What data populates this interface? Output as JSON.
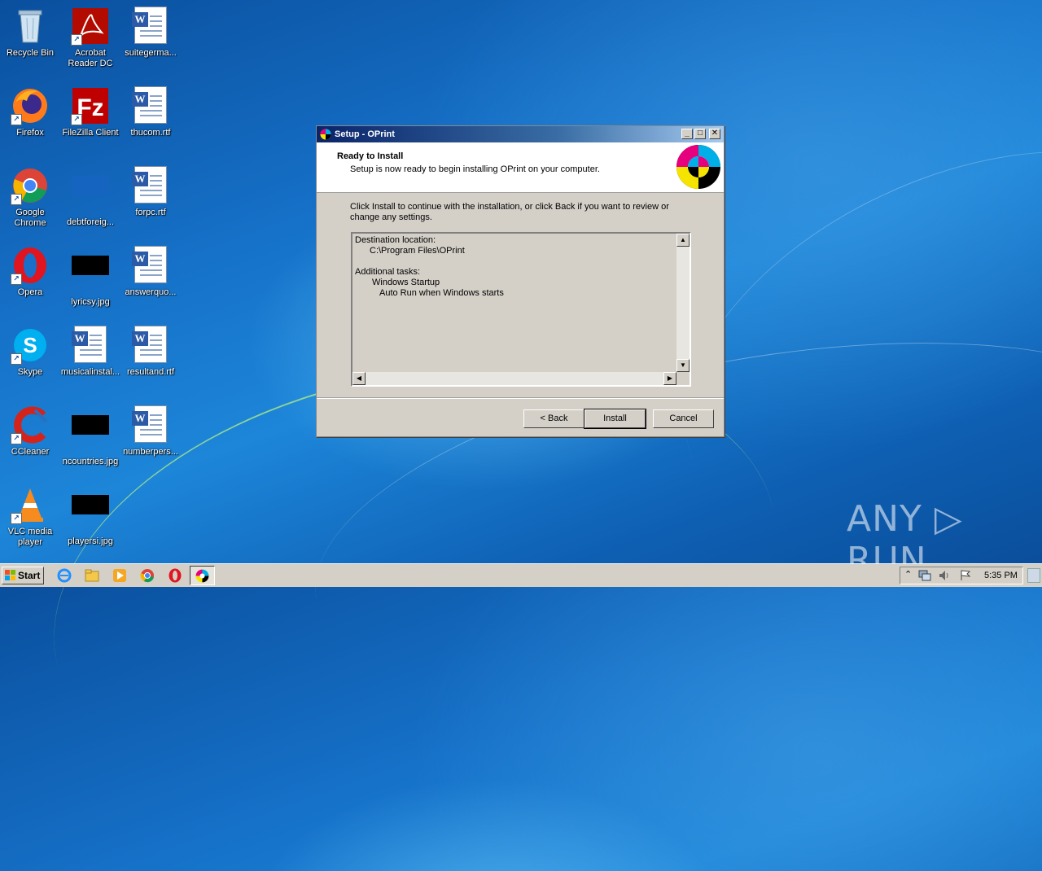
{
  "desktop": {
    "icons": [
      {
        "label": "Recycle Bin"
      },
      {
        "label": "Acrobat Reader DC"
      },
      {
        "label": "suitegerma..."
      },
      {
        "label": "Firefox"
      },
      {
        "label": "FileZilla Client"
      },
      {
        "label": "thucom.rtf"
      },
      {
        "label": "Google Chrome"
      },
      {
        "label": "debtforeig..."
      },
      {
        "label": "forpc.rtf"
      },
      {
        "label": "Opera"
      },
      {
        "label": "lyricsy.jpg"
      },
      {
        "label": "answerquo..."
      },
      {
        "label": "Skype"
      },
      {
        "label": "musicalinstal..."
      },
      {
        "label": "resultand.rtf"
      },
      {
        "label": "CCleaner"
      },
      {
        "label": "ncountries.jpg"
      },
      {
        "label": "numberpers..."
      },
      {
        "label": "VLC media player"
      },
      {
        "label": "playersi.jpg"
      }
    ]
  },
  "dialog": {
    "title": "Setup - OPrint",
    "heading": "Ready to Install",
    "subheading": "Setup is now ready to begin installing OPrint on your computer.",
    "intro": "Click Install to continue with the installation, or click Back if you want to review or change any settings.",
    "memo": {
      "dest_label": "Destination location:",
      "dest_value": "C:\\Program Files\\OPrint",
      "tasks_label": "Additional tasks:",
      "task_group": "Windows Startup",
      "task_item": "Auto Run when Windows starts"
    },
    "buttons": {
      "back": "< Back",
      "install": "Install",
      "cancel": "Cancel"
    }
  },
  "taskbar": {
    "start_label": "Start",
    "clock": "5:35 PM"
  },
  "watermark": "ANY ▷ RUN",
  "colors": {
    "desktop_blue": "#1672c9",
    "titlebar": "#0a246a",
    "dialog_face": "#d4d0c8"
  }
}
